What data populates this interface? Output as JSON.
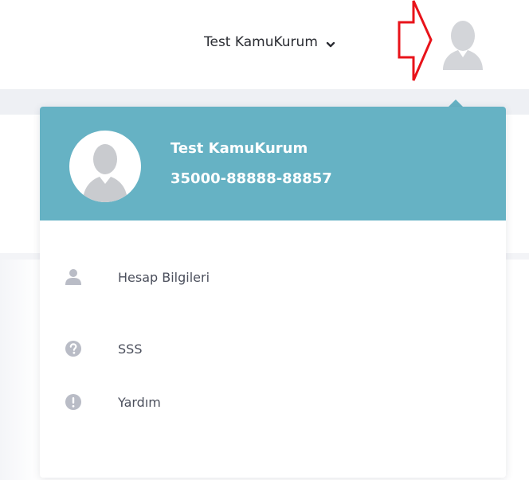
{
  "header": {
    "user_name": "Test KamuKurum",
    "icons": {
      "dropdown": "chevron-down-icon",
      "avatar": "user-avatar-icon",
      "annotation": "red-arrow-outline-icon"
    }
  },
  "dropdown": {
    "profile": {
      "name": "Test KamuKurum",
      "id": "35000-88888-88857"
    },
    "menu": [
      {
        "label": "Hesap Bilgileri",
        "icon": "user-icon"
      },
      {
        "label": "SSS",
        "icon": "question-circle-icon"
      },
      {
        "label": "Yardım",
        "icon": "exclamation-circle-icon"
      }
    ]
  },
  "colors": {
    "header_bg": "#66b2c4",
    "annotation_arrow": "#e8131a",
    "icon_gray": "#b9bcc6",
    "text": "#4b4f5c"
  }
}
